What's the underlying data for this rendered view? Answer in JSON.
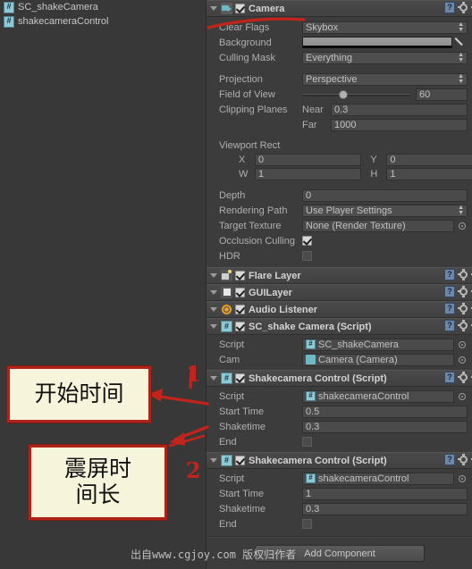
{
  "project_panel": {
    "items": [
      {
        "label": "SC_shakeCamera",
        "icon": "csharp-script-icon"
      },
      {
        "label": "shakecameraControl",
        "icon": "csharp-script-icon"
      }
    ]
  },
  "inspector": {
    "components": [
      {
        "title": "Camera",
        "icon": "camera-icon",
        "enabled": true,
        "fields": {
          "clear_flags_label": "Clear Flags",
          "clear_flags_value": "Skybox",
          "background_label": "Background",
          "culling_mask_label": "Culling Mask",
          "culling_mask_value": "Everything",
          "projection_label": "Projection",
          "projection_value": "Perspective",
          "fov_label": "Field of View",
          "fov_value": "60",
          "clipping_label": "Clipping Planes",
          "near_label": "Near",
          "near_value": "0.3",
          "far_label": "Far",
          "far_value": "1000",
          "viewport_label": "Viewport Rect",
          "vp_x_label": "X",
          "vp_x_value": "0",
          "vp_y_label": "Y",
          "vp_y_value": "0",
          "vp_w_label": "W",
          "vp_w_value": "1",
          "vp_h_label": "H",
          "vp_h_value": "1",
          "depth_label": "Depth",
          "depth_value": "0",
          "rendering_path_label": "Rendering Path",
          "rendering_path_value": "Use Player Settings",
          "target_texture_label": "Target Texture",
          "target_texture_value": "None (Render Texture)",
          "occlusion_label": "Occlusion Culling",
          "hdr_label": "HDR"
        }
      },
      {
        "title": "Flare Layer",
        "icon": "flare-layer-icon",
        "enabled": true
      },
      {
        "title": "GUILayer",
        "icon": "gui-layer-icon",
        "enabled": true
      },
      {
        "title": "Audio Listener",
        "icon": "audio-listener-icon",
        "enabled": true
      },
      {
        "title": "SC_shake Camera (Script)",
        "icon": "csharp-script-icon",
        "enabled": true,
        "script_label": "Script",
        "script_value": "SC_shakeCamera",
        "cam_label": "Cam",
        "cam_value": "Camera (Camera)"
      },
      {
        "title": "Shakecamera Control (Script)",
        "icon": "csharp-script-icon",
        "enabled": true,
        "script_label": "Script",
        "script_value": "shakecameraControl",
        "start_time_label": "Start Time",
        "start_time_value": "0.5",
        "shaketime_label": "Shaketime",
        "shaketime_value": "0.3",
        "end_label": "End"
      },
      {
        "title": "Shakecamera Control (Script)",
        "icon": "csharp-script-icon",
        "enabled": true,
        "script_label": "Script",
        "script_value": "shakecameraControl",
        "start_time_label": "Start Time",
        "start_time_value": "1",
        "shaketime_label": "Shaketime",
        "shaketime_value": "0.3",
        "end_label": "End"
      }
    ],
    "add_component_label": "Add Component"
  },
  "annotations": {
    "box1_text": "开始时间",
    "box2_line1": "震屏时",
    "box2_line2": "间长",
    "marker1": "1",
    "marker2": "2",
    "accent_color": "#b02318",
    "box_fill_color": "#f7f4dc"
  },
  "watermark": {
    "text": "出自www.cgjoy.com 版权归作者"
  }
}
